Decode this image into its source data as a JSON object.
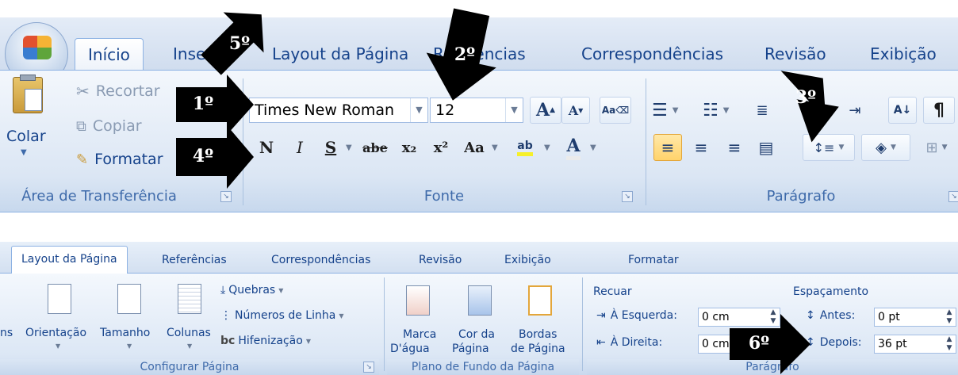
{
  "top_ribbon": {
    "tabs": [
      {
        "label": "Início",
        "active": true
      },
      {
        "label": "Inserir"
      },
      {
        "label": "Layout da Página"
      },
      {
        "label": "Referências"
      },
      {
        "label": "Correspondências"
      },
      {
        "label": "Revisão"
      },
      {
        "label": "Exibição"
      }
    ],
    "clipboard": {
      "paste": "Colar",
      "cut": "Recortar",
      "copy": "Copiar",
      "format": "Formatar",
      "group": "Área de Transferência"
    },
    "font": {
      "name": "Times New Roman",
      "size": "12",
      "grow": "A",
      "shrink": "A",
      "bold": "N",
      "italic": "I",
      "underline": "S",
      "strike": "abe",
      "sub": "x₂",
      "sup": "x²",
      "case": "Aa",
      "highlight": "ab",
      "color": "A",
      "group": "Fonte"
    },
    "paragraph": {
      "sort": "A↓",
      "marks": "¶",
      "group": "Parágrafo"
    }
  },
  "bottom_ribbon": {
    "tabs": [
      {
        "label": "Layout da Página",
        "active": true
      },
      {
        "label": "Referências"
      },
      {
        "label": "Correspondências"
      },
      {
        "label": "Revisão"
      },
      {
        "label": "Exibição"
      },
      {
        "label": "Formatar"
      }
    ],
    "page_setup": {
      "margins_tail": "ns",
      "orientation": "Orientação",
      "size": "Tamanho",
      "columns": "Colunas",
      "breaks": "Quebras",
      "line_numbers": "Números de Linha",
      "hyphenation": "Hifenização",
      "hyph_glyph": "bc",
      "group": "Configurar Página"
    },
    "page_background": {
      "watermark_1": "Marca",
      "watermark_2": "D'água",
      "color_1": "Cor da",
      "color_2": "Página",
      "borders_1": "Bordas",
      "borders_2": "de Página",
      "group": "Plano de Fundo da Página"
    },
    "paragraph": {
      "indent": "Recuar",
      "left_label": "À Esquerda:",
      "left_value": "0 cm",
      "right_label": "À Direita:",
      "right_value": "0 cm",
      "spacing": "Espaçamento",
      "before_label": "Antes:",
      "before_value": "0 pt",
      "after_label": "Depois:",
      "after_value": "36 pt",
      "group": "Parágrafo"
    }
  },
  "callouts": [
    "1º",
    "2º",
    "3º",
    "4º",
    "5º",
    "6º"
  ],
  "colors": {
    "callout_fill": "#000000",
    "ribbon_text": "#15428b",
    "ribbon_bg": "#dbe6f4"
  }
}
